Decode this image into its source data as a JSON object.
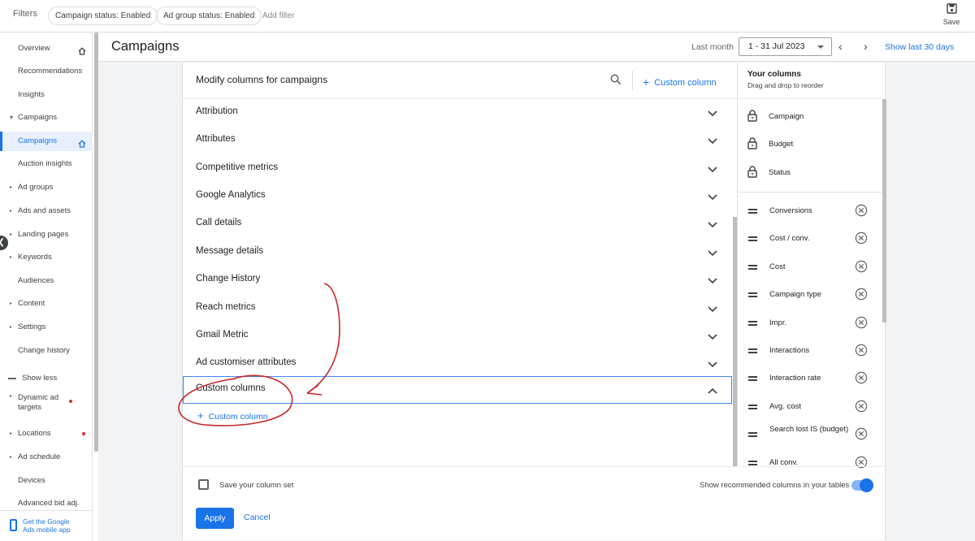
{
  "filters": {
    "label": "Filters",
    "chips": [
      "Campaign status: Enabled",
      "Ad group status: Enabled"
    ],
    "add_filter": "Add filter",
    "save_label": "Save"
  },
  "sidebar": {
    "items": [
      {
        "label": "Overview",
        "home": true
      },
      {
        "label": "Recommendations"
      },
      {
        "label": "Insights"
      },
      {
        "label": "Campaigns",
        "expanded": true
      },
      {
        "label": "Campaigns",
        "active": true,
        "home": true
      },
      {
        "label": "Auction insights"
      },
      {
        "label": "Ad groups",
        "caret": true
      },
      {
        "label": "Ads and assets",
        "caret": true
      },
      {
        "label": "Landing pages",
        "caret": true
      },
      {
        "label": "Keywords",
        "caret": true
      },
      {
        "label": "Audiences"
      },
      {
        "label": "Content",
        "caret": true
      },
      {
        "label": "Settings",
        "caret": true
      },
      {
        "label": "Change history"
      },
      {
        "label": "Show less"
      },
      {
        "label": "Dynamic ad targets",
        "caret": true,
        "dot": true
      },
      {
        "label": "Locations",
        "caret": true,
        "dot": true
      },
      {
        "label": "Ad schedule",
        "caret": true
      },
      {
        "label": "Devices"
      },
      {
        "label": "Advanced bid adj."
      }
    ],
    "mobile_app": "Get the Google Ads mobile app"
  },
  "header": {
    "title": "Campaigns",
    "range_label": "Last month",
    "date_range": "1 - 31 Jul 2023",
    "show_last": "Show last 30 days"
  },
  "modal": {
    "title": "Modify columns for campaigns",
    "custom_column": "Custom column",
    "categories": [
      "Attribution",
      "Attributes",
      "Competitive metrics",
      "Google Analytics",
      "Call details",
      "Message details",
      "Change History",
      "Reach metrics",
      "Gmail Metric",
      "Ad customiser attributes",
      "Custom columns"
    ],
    "expanded_category": "Custom columns",
    "inner_custom_column": "Custom column",
    "your_columns": {
      "title": "Your columns",
      "subtitle": "Drag and drop to reorder",
      "locked": [
        "Campaign",
        "Budget",
        "Status"
      ],
      "columns": [
        "Conversions",
        "Cost / conv.",
        "Cost",
        "Campaign type",
        "Impr.",
        "Interactions",
        "Interaction rate",
        "Avg. cost",
        "Search lost IS (budget)",
        "All conv."
      ]
    },
    "footer": {
      "save_set": "Save your column set",
      "save_set_checked": false,
      "show_recommended": "Show recommended columns in your tables",
      "show_recommended_on": true,
      "apply": "Apply",
      "cancel": "Cancel"
    }
  },
  "colors": {
    "accent": "#1a73e8",
    "annotation": "#c62828"
  }
}
